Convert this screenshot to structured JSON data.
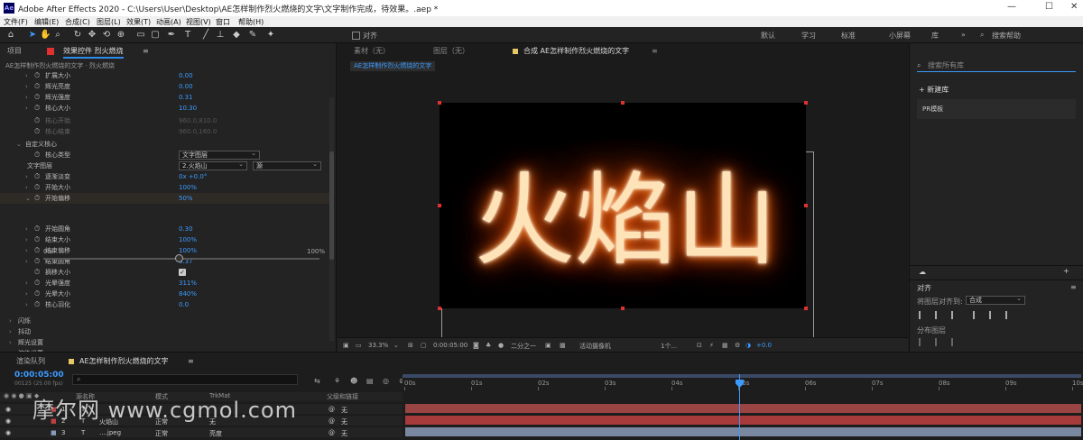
{
  "window": {
    "title": "Adobe After Effects 2020 - C:\\Users\\User\\Desktop\\AE怎样制作烈火燃烧的文字\\文字制作完成，待效果。.aep *"
  },
  "menu": [
    "文件(F)",
    "编辑(E)",
    "合成(C)",
    "图层(L)",
    "效果(T)",
    "动画(A)",
    "视图(V)",
    "窗口",
    "帮助(H)"
  ],
  "toolbar": {
    "align_label": "对齐",
    "workspaces": [
      "默认",
      "学习",
      "标准",
      "小屏幕",
      "库"
    ],
    "search_placeholder": "搜索帮助"
  },
  "left_panel": {
    "tab_project": "项目",
    "tab_effect_controls": "效果控件 烈火燃烧",
    "breadcrumb": "AE怎样制作烈火燃烧的文字 · 烈火燃烧",
    "rows": [
      {
        "name": "扩展大小",
        "value": "0.00"
      },
      {
        "name": "辉光亮度",
        "value": "0.00"
      },
      {
        "name": "辉光强度",
        "value": "0.31"
      },
      {
        "name": "核心大小",
        "value": "10.30"
      },
      {
        "name": "核心开始",
        "value": "960.0,810.0"
      },
      {
        "name": "核心结束",
        "value": "960.0,160.0"
      },
      {
        "name": "自定义核心",
        "value": ""
      },
      {
        "name": "核心类型",
        "value": "文字图层"
      },
      {
        "name": "文字图层",
        "value": "2.火焰山",
        "extra": "源"
      },
      {
        "name": "逐渐淡变",
        "value": "0x +0.0°"
      },
      {
        "name": "开始大小",
        "value": "100%"
      },
      {
        "name": "开始偏移",
        "value": "50%"
      },
      {
        "name": "开始圆角",
        "value": "0.30"
      },
      {
        "name": "结束大小",
        "value": "100%"
      },
      {
        "name": "结束偏移",
        "value": "100%"
      },
      {
        "name": "结束圆角",
        "value": "0.37"
      },
      {
        "name": "摘移大小",
        "value": ""
      },
      {
        "name": "光晕强度",
        "value": "311%"
      },
      {
        "name": "光晕大小",
        "value": "840%"
      },
      {
        "name": "核心羽化",
        "value": "0.0"
      },
      {
        "name": "闪烁",
        "value": ""
      },
      {
        "name": "抖动",
        "value": ""
      },
      {
        "name": "辉光设置",
        "value": ""
      },
      {
        "name": "渲染设置",
        "value": ""
      }
    ],
    "slider_min": "0%",
    "slider_max": "100%",
    "slider_value_fraction": 0.5
  },
  "viewer": {
    "tab_footage": "素材（无）",
    "tab_layer": "图层（无）",
    "tab_comp": "合成 AE怎样制作烈火燃烧的文字",
    "subtab": "AE怎样制作烈火燃烧的文字",
    "fire_text": "火焰山",
    "zoom": "33.3%",
    "timecode": "0:00:05:00",
    "resolution": "二分之一",
    "camera": "活动摄像机",
    "views": "1个...",
    "exposure": "+0.0"
  },
  "right_panel": {
    "lib_search_placeholder": "搜索所有库",
    "new_library": "+ 新建库",
    "library_item": "PR模板",
    "align_title": "对齐",
    "align_to_label": "将图层对齐到:",
    "align_to_value": "合成",
    "distribute_label": "分布图层"
  },
  "timeline": {
    "tab_render": "渲染队列",
    "tab_comp": "AE怎样制作烈火燃烧的文字",
    "timecode": "0:00:05:00",
    "timecode_sub": "00125 (25.00 fps)",
    "ruler_ticks": [
      "00s",
      "01s",
      "02s",
      "03s",
      "04s",
      "05s",
      "06s",
      "07s",
      "08s",
      "09s",
      "10s"
    ],
    "columns": {
      "source": "源名称",
      "mode": "模式",
      "trkmat": "TrkMat",
      "parent": "父级和链接"
    },
    "layers": [
      {
        "num": "1",
        "name": "",
        "mode": "",
        "trkmat": "",
        "parent": "无",
        "color": "#b04b4b"
      },
      {
        "num": "2",
        "name": "火焰山",
        "mode": "正常",
        "trkmat": "无",
        "parent": "无",
        "color": "#c04040"
      },
      {
        "num": "3",
        "name": "....jpeg",
        "mode": "正常",
        "trkmat": "亮度",
        "parent": "无",
        "color": "#8a9ab8"
      }
    ],
    "watermark": "摩尔网 www.cgmol.com"
  }
}
